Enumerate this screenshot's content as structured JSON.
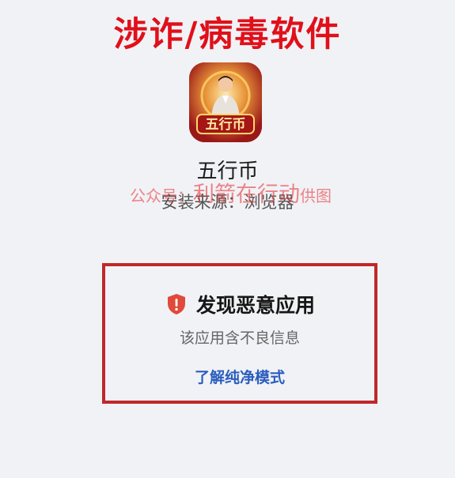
{
  "banner": {
    "text": "涉诈/病毒软件"
  },
  "app": {
    "name": "五行币",
    "icon_text": "五行币",
    "source": "安装来源：浏览器",
    "icon": "app-icon"
  },
  "watermark": {
    "prefix": "公众号：",
    "middle": "利箭在行动",
    "suffix": "供图"
  },
  "alert": {
    "icon": "shield-warning-icon",
    "title": "发现恶意应用",
    "description": "该应用含不良信息",
    "link_label": "了解纯净模式"
  },
  "colors": {
    "banner": "#e0101a",
    "shield": "#e04a3a",
    "link": "#2a5dbd",
    "frame": "#c0282a",
    "background": "#f1f2f6"
  }
}
